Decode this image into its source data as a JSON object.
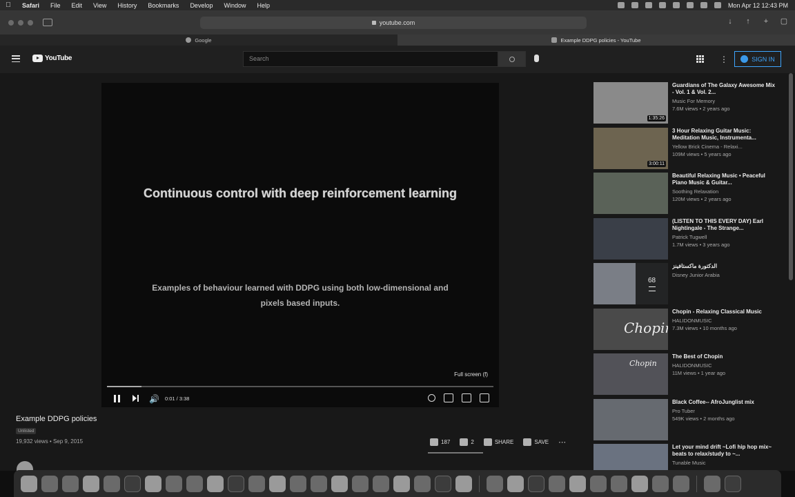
{
  "menubar": {
    "items": [
      "Safari",
      "File",
      "Edit",
      "View",
      "History",
      "Bookmarks",
      "Develop",
      "Window",
      "Help"
    ],
    "clock": "Mon Apr 12  12:43 PM"
  },
  "browser": {
    "url": "youtube.com",
    "tabs": [
      {
        "label": "Google",
        "active": false
      },
      {
        "label": "Example DDPG policies - YouTube",
        "active": true
      }
    ]
  },
  "header": {
    "logo": "YouTube",
    "search_placeholder": "Search",
    "signin_label": "SIGN IN"
  },
  "player": {
    "slide_title": "Continuous control with deep reinforcement learning",
    "slide_subtitle": "Examples of behaviour learned with DDPG using both low-dimensional and pixels based inputs.",
    "fullscreen_tip": "Full screen (f)",
    "time": "0:01 / 3:38",
    "progress": 0.09
  },
  "video": {
    "title": "Example DDPG policies",
    "badge": "Unlisted",
    "meta": "19,932 views • Sep 9, 2015",
    "likes": "187",
    "dislikes": "2",
    "share": "SHARE",
    "save": "SAVE"
  },
  "sidebar": {
    "items": [
      {
        "title": "Guardians of The Galaxy Awesome Mix - Vol. 1 & Vol. 2...",
        "channel": "Music For Memory",
        "meta": "7.6M views • 2 years ago",
        "duration": "1:35:26",
        "color": "#8a8a8a"
      },
      {
        "title": "3 Hour Relaxing Guitar Music: Meditation Music, Instrumenta...",
        "channel": "Yellow Brick Cinema - Relaxi...",
        "meta": "109M views • 5 years ago",
        "duration": "3:00:11",
        "color": "#6d6450"
      },
      {
        "title": "Beautiful Relaxing Music • Peaceful Piano Music & Guitar...",
        "channel": "Soothing Relaxation",
        "meta": "120M views • 2 years ago",
        "duration": "",
        "color": "#5a6258"
      },
      {
        "title": "(LISTEN TO THIS EVERY DAY) Earl Nightingale - The Strange...",
        "channel": "Patrick Tugwell",
        "meta": "1.7M views • 3 years ago",
        "duration": "",
        "color": "#3a3f48"
      },
      {
        "title": "الدكتورة ماكستافينز",
        "channel": "Disney Junior Arabia",
        "meta": "",
        "duration": "",
        "playlist_count": "68",
        "color": "#7a7e86"
      },
      {
        "title": "Chopin - Relaxing Classical Music",
        "channel": "HALIDONMUSIC",
        "meta": "7.3M views • 10 months ago",
        "duration": "",
        "thumb_text": "Chopin",
        "color": "#4a4a4a"
      },
      {
        "title": "The Best of Chopin",
        "channel": "HALIDONMUSIC",
        "meta": "11M views • 1 year ago",
        "duration": "",
        "thumb_text": "Chopin",
        "color": "#525258"
      },
      {
        "title": "Black Coffee-- AfroJunglist mix",
        "channel": "Pro Tuber",
        "meta": "549K views • 2 months ago",
        "duration": "",
        "color": "#666a70"
      },
      {
        "title": "Let your mind drift ~Lofi hip hop mix~ beats to relax/study to ~...",
        "channel": "Tunable Music",
        "meta": "",
        "duration": "",
        "color": "#6a7280"
      }
    ]
  }
}
